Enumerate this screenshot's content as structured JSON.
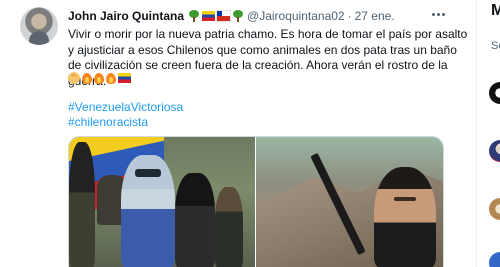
{
  "tweet": {
    "author_name": "John Jairo Quintana",
    "author_emojis": [
      "tree-emoji",
      "venezuela-flag-emoji",
      "chile-flag-emoji",
      "tree-emoji"
    ],
    "handle": "@Jairoquintana02",
    "separator": "·",
    "date": "27 ene.",
    "text": "Vivir o morir por la nueva patria chamo. Es hora de tomar el país por asalto y ajusticiar a esos Chilenos que como animales en dos pata tras un baño de civilización se creen fuera de la creación. Ahora verán el rostro de la guerra.",
    "text_emojis": [
      "palm-emoji",
      "fire-emoji",
      "fire-emoji",
      "fire-emoji",
      "venezuela-flag-emoji"
    ],
    "hashtags": [
      "#VenezuelaVictoriosa",
      "#chilenoracista"
    ]
  },
  "right_rail": {
    "title": "M",
    "subtitle": "Sc"
  }
}
